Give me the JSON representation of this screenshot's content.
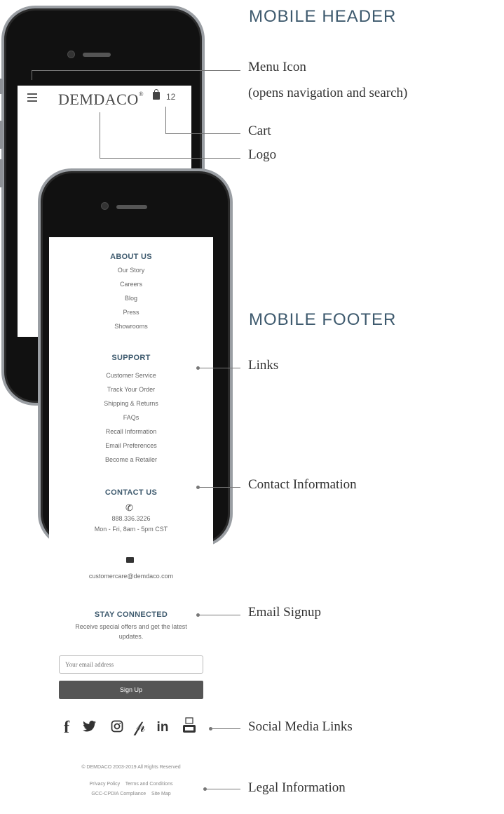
{
  "sections": {
    "header_title": "MOBILE HEADER",
    "footer_title": "MOBILE FOOTER"
  },
  "header_phone": {
    "logo": "DEMDACO",
    "logo_mark": "®",
    "cart_count": "12"
  },
  "callouts": {
    "menu_icon": "Menu Icon",
    "menu_icon_desc": "(opens navigation and search)",
    "cart": "Cart",
    "logo": "Logo",
    "links": "Links",
    "contact": "Contact Information",
    "email_signup": "Email Signup",
    "social": "Social Media Links",
    "legal": "Legal Information"
  },
  "footer": {
    "about": {
      "title": "ABOUT US",
      "links": [
        "Our Story",
        "Careers",
        "Blog",
        "Press",
        "Showrooms"
      ]
    },
    "support": {
      "title": "SUPPORT",
      "links": [
        "Customer Service",
        "Track Your Order",
        "Shipping & Returns",
        "FAQs",
        "Recall Information",
        "Email Preferences",
        "Become a Retailer"
      ]
    },
    "contact": {
      "title": "CONTACT US",
      "phone": "888.336.3226",
      "hours": "Mon - Fri, 8am - 5pm CST",
      "email": "customercare@demdaco.com"
    },
    "stay_connected": {
      "title": "STAY CONNECTED",
      "text_line1": "Receive special offers and get the latest",
      "text_line2": "updates.",
      "email_placeholder": "Your email address",
      "signup_label": "Sign Up"
    },
    "social_icons": [
      "facebook-icon",
      "twitter-icon",
      "instagram-icon",
      "pinterest-icon",
      "linkedin-icon",
      "youtube-icon"
    ],
    "legal": {
      "copyright": "© DEMDACO 2003-2019 All Rights Reserved",
      "privacy": "Privacy Policy",
      "terms": "Terms and Conditions",
      "gcc": "GCC-CPDIA Compliance",
      "sitemap": "Site Map"
    }
  },
  "colors": {
    "heading_blue": "#3e5a6e",
    "button_gray": "#555555",
    "phone_black": "#111111"
  }
}
